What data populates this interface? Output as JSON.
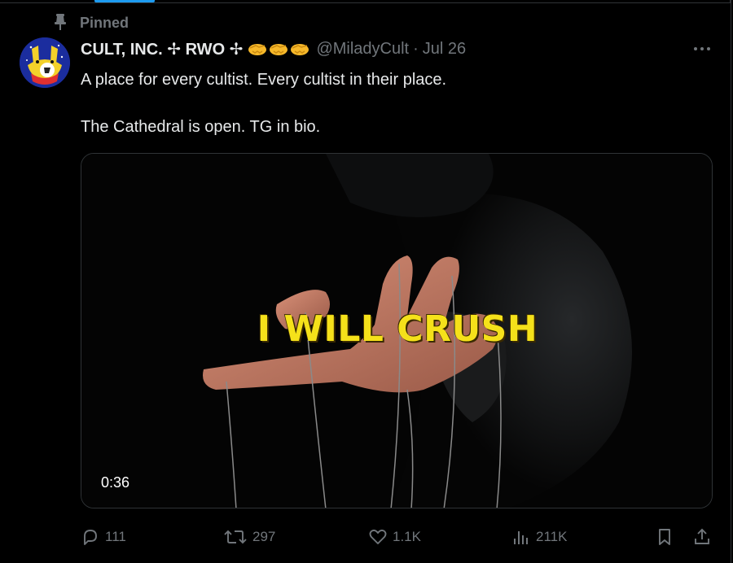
{
  "pinned": {
    "label": "Pinned",
    "icon": "pin-icon"
  },
  "author": {
    "display_name": "CULT, INC. ✢ RWO ✢",
    "handle": "@MiladyCult",
    "separator": "·",
    "date": "Jul 26",
    "emojis": [
      "handshake-icon",
      "handshake-icon",
      "handshake-icon"
    ]
  },
  "tweet": {
    "line1": "A place for every cultist. Every cultist in their place.",
    "line2": "The Cathedral is open. TG in bio."
  },
  "media": {
    "caption": "I WILL CRUSH",
    "duration": "0:36",
    "caption_color": "#f5e11a"
  },
  "actions": {
    "replies": "111",
    "reposts": "297",
    "likes": "1.1K",
    "views": "211K"
  },
  "colors": {
    "background": "#000000",
    "text": "#e7e9ea",
    "muted": "#71767b",
    "border": "#2f3336",
    "accent": "#1d9bf0"
  }
}
